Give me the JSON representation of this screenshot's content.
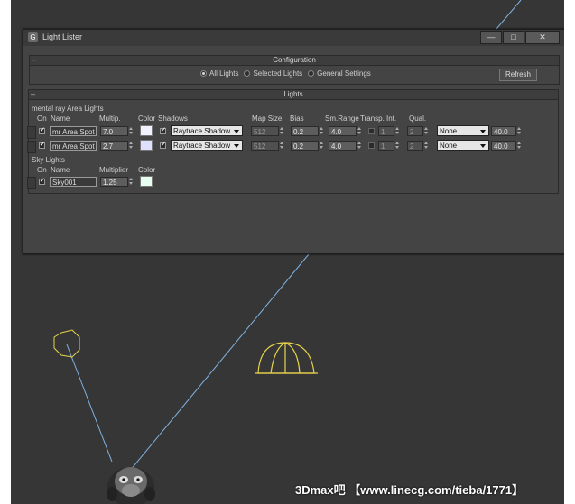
{
  "window": {
    "title": "Light Lister",
    "icon_glyph": "G",
    "buttons": {
      "minimize": "—",
      "maximize": "□",
      "close": "✕"
    }
  },
  "configuration": {
    "header": "Configuration",
    "collapse": "–",
    "radios": [
      {
        "label": "All Lights",
        "selected": true
      },
      {
        "label": "Selected Lights",
        "selected": false
      },
      {
        "label": "General Settings",
        "selected": false
      }
    ],
    "refresh_label": "Refresh"
  },
  "lights": {
    "header": "Lights",
    "collapse": "–",
    "area_group": {
      "title": "mental ray Area Lights",
      "headers": {
        "on": "On",
        "name": "Name",
        "multip": "Multip.",
        "color": "Color",
        "shadows": "Shadows",
        "map_size": "Map Size",
        "bias": "Bias",
        "sm_range": "Sm.Range",
        "transp": "Transp.",
        "int": "Int.",
        "qual": "Qual."
      },
      "rows": [
        {
          "on": true,
          "name": "mr Area Spot",
          "multip": "7.0",
          "color": "#f2f2ff",
          "shadows_on": true,
          "shadow_type": "Raytrace Shadow",
          "map_size": "512",
          "bias": "0.2",
          "sm_range": "4.0",
          "transp": false,
          "int": "1",
          "qual": "2",
          "decay": "None",
          "value": "40.0"
        },
        {
          "on": true,
          "name": "mr Area Spot",
          "multip": "2.7",
          "color": "#dfe0ff",
          "shadows_on": true,
          "shadow_type": "Raytrace Shadow",
          "map_size": "512",
          "bias": "0.2",
          "sm_range": "4.0",
          "transp": false,
          "int": "1",
          "qual": "2",
          "decay": "None",
          "value": "40.0"
        }
      ]
    },
    "sky_group": {
      "title": "Sky Lights",
      "headers": {
        "on": "On",
        "name": "Name",
        "multiplier": "Multiplier",
        "color": "Color"
      },
      "rows": [
        {
          "on": true,
          "name": "Sky001",
          "multiplier": "1.25",
          "color": "#e6fff0"
        }
      ]
    }
  },
  "watermark": "3Dmax吧 【www.linecg.com/tieba/1771】",
  "colors": {
    "viewport": "#363636",
    "panel": "#444444",
    "light_cone": "#e8d44d",
    "ray": "#7fb2e0"
  }
}
